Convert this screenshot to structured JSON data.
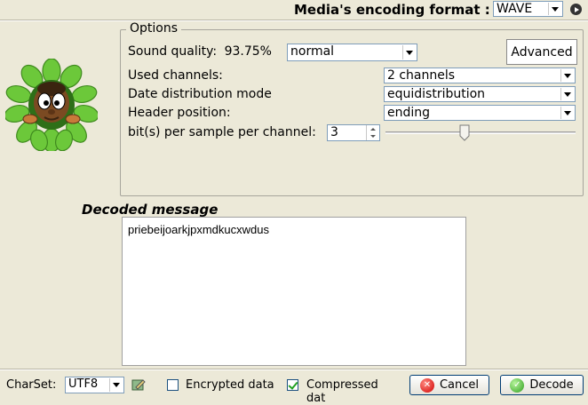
{
  "header": {
    "media_format_label": "Media's encoding format :",
    "media_format_value": "WAVE"
  },
  "options": {
    "legend": "Options",
    "sound_quality": {
      "label": "Sound quality:",
      "percent": "93.75%",
      "value": "normal"
    },
    "advanced_label": "Advanced",
    "used_channels": {
      "label": "Used channels:",
      "value": "2 channels"
    },
    "date_distribution": {
      "label": "Date distribution mode",
      "value": "equidistribution"
    },
    "header_position": {
      "label": "Header position:",
      "value": "ending"
    },
    "bits_per_sample": {
      "label": "bit(s) per sample per channel:",
      "value": "3",
      "slider_fraction": 0.41
    }
  },
  "decoded": {
    "label": "Decoded message",
    "text": "priebeijoarkjpxmdkucxwdus"
  },
  "footer": {
    "charset_label": "CharSet:",
    "charset_value": "UTF8",
    "encrypted_label": "Encrypted data",
    "encrypted_checked": false,
    "compressed_label": "Compressed dat",
    "compressed_checked": true,
    "cancel_label": "Cancel",
    "decode_label": "Decode"
  },
  "colors": {
    "background": "#ece9d8",
    "leaf_green": "#6cc83a",
    "cancel_red": "#d10000",
    "decode_green": "#2f9e1f"
  }
}
